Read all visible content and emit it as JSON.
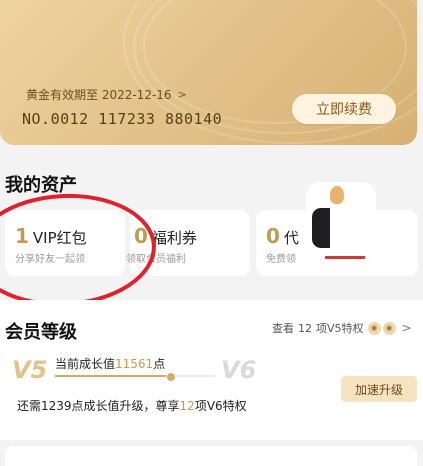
{
  "gold_card": {
    "expire_label": "黄金有效期至 2022-12-16",
    "card_number": "NO.0012 117233 880140",
    "renew_button": "立即续费"
  },
  "assets": {
    "title": "我的资产",
    "cards": [
      {
        "number": "1",
        "label": "VIP红包",
        "sub": "分享好友一起领"
      },
      {
        "number": "0",
        "label": "福利券",
        "sub": "领取会员福利"
      },
      {
        "number": "0",
        "label": "代",
        "sub": "免费领"
      }
    ]
  },
  "level": {
    "title": "会员等级",
    "link_prefix": "查看",
    "link_count": "12",
    "link_suffix": "项V5特权",
    "current_level": "V5",
    "next_level": "V6",
    "growth_prefix": "当前成长值",
    "growth_value": "11561",
    "growth_suffix": "点",
    "progress_fraction": 0.72,
    "upgrade_prefix": "还需1239点成长值升级，尊享",
    "upgrade_count": "12",
    "upgrade_suffix": "项V6特权",
    "boost_button": "加速升级"
  },
  "colors": {
    "gold_accent": "#c49a52",
    "annotation_circle": "#e0202a"
  }
}
